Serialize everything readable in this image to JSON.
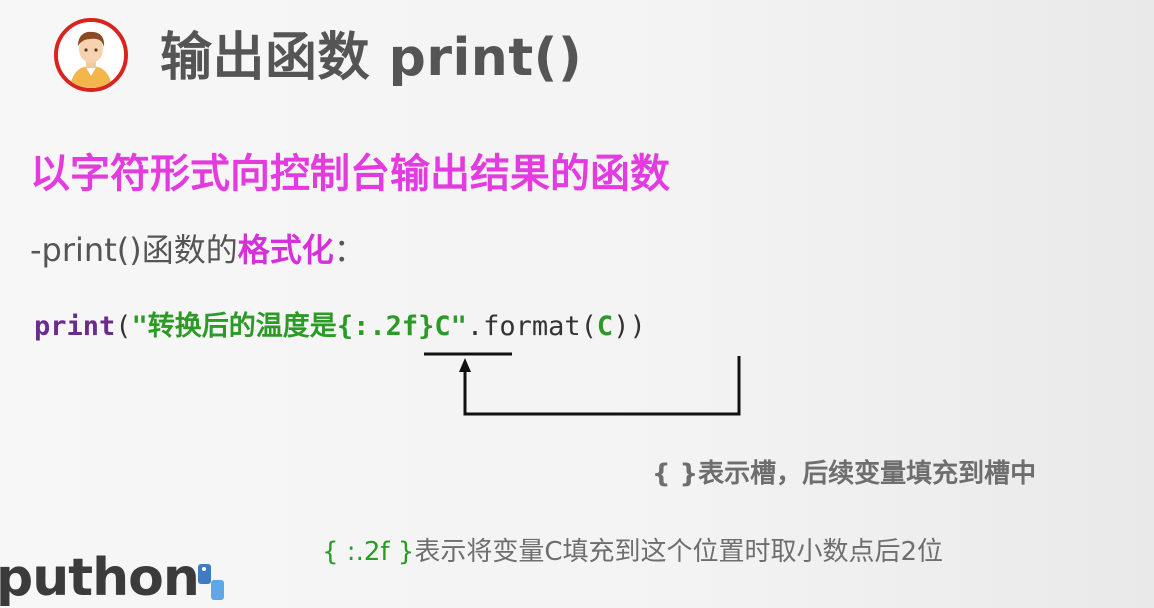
{
  "slide": {
    "title": "输出函数 print()",
    "heading": "以字符形式向控制台输出结果的函数",
    "subline": {
      "prefix": "-print()函数的",
      "emphasis": "格式化",
      "suffix": "："
    },
    "code": {
      "func": "print",
      "open_paren": "(",
      "str_open": "\"转换后的温度是",
      "slot": "{:.2f}",
      "str_close": "C\"",
      "method": ".format(",
      "arg": "C",
      "close": "))"
    },
    "notes": {
      "note1": "{ }表示槽，后续变量填充到槽中",
      "note2_slot": "{ :.2f }",
      "note2_text": "表示将变量C填充到这个位置时取小数点后2位"
    },
    "logo_text": "puthon"
  },
  "icons": {
    "avatar": "person-avatar-icon",
    "logo_mark": "python-logo-icon"
  },
  "colors": {
    "title": "#555555",
    "heading": "#e33be0",
    "keyword": "#6b2d8a",
    "string": "#2b9a27",
    "avatar_ring": "#d8231e"
  }
}
